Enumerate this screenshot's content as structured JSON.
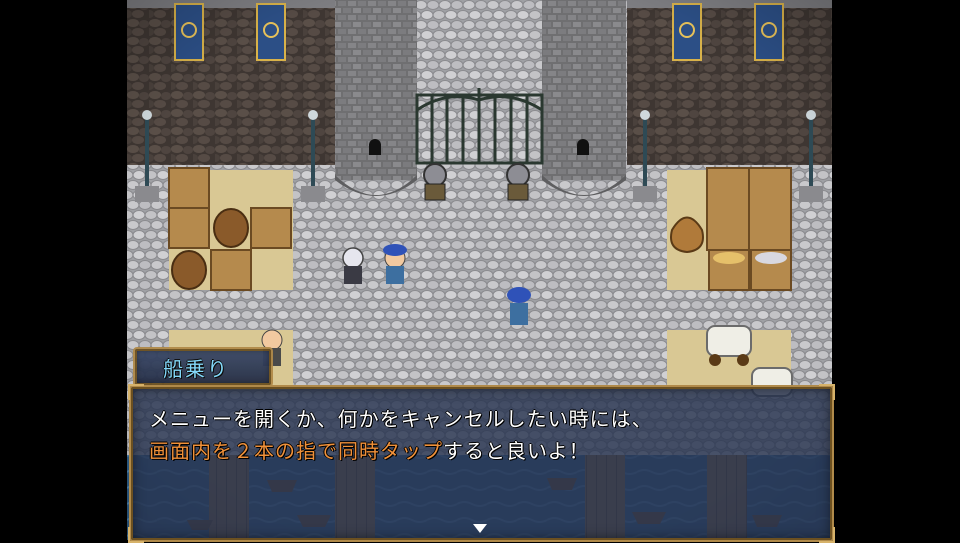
{
  "dialog": {
    "speaker": "船乗り",
    "line1": "メニューを開くか、何かをキャンセルしたい時には、",
    "line2_highlight": "画面内を２本の指で同時タップ",
    "line2_rest": "すると良いよ！"
  },
  "colors": {
    "speaker": "#7fd9ff",
    "highlight": "#f0913a",
    "text": "#ffffff",
    "window": "#283450",
    "frame": "#b08a4a"
  },
  "scene": {
    "location": "castle gate plaza",
    "npcs": [
      "guard-left",
      "guard-right",
      "white-haired-hero",
      "sailor-blue-cap",
      "sailor-walking",
      "merchant-old-man"
    ],
    "icons": [
      "advance-cursor-icon"
    ]
  }
}
